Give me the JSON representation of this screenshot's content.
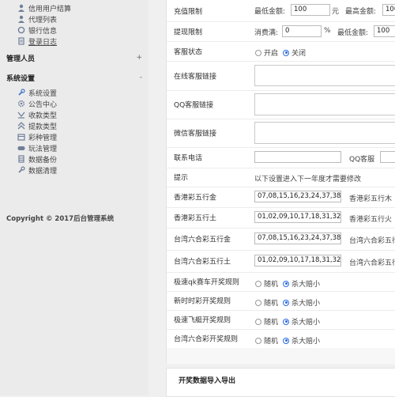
{
  "sidebar": {
    "menu_top": [
      {
        "label": "信用用户结算",
        "icon": "user-icon"
      },
      {
        "label": "代理列表",
        "icon": "user-icon"
      },
      {
        "label": "银行信息",
        "icon": "circle-icon"
      },
      {
        "label": "登录日志",
        "icon": "document-icon"
      }
    ],
    "groups": [
      {
        "label": "管理人员",
        "toggle": "+"
      },
      {
        "label": "系统设置",
        "toggle": "-"
      }
    ],
    "settings_items": [
      {
        "label": "系统设置",
        "icon": "wrench-icon"
      },
      {
        "label": "公告中心",
        "icon": "gear-icon"
      },
      {
        "label": "收款类型",
        "icon": "download-icon"
      },
      {
        "label": "提款类型",
        "icon": "upload-icon"
      },
      {
        "label": "彩种管理",
        "icon": "folder-icon"
      },
      {
        "label": "玩法管理",
        "icon": "gamepad-icon"
      },
      {
        "label": "数据备份",
        "icon": "database-icon"
      },
      {
        "label": "数据清理",
        "icon": "wrench-icon"
      }
    ],
    "copyright": "Copyright © 2017后台管理系统"
  },
  "form": {
    "recharge": {
      "label": "充值限制",
      "min_label": "最低金额:",
      "min_value": "100",
      "unit": "元",
      "max_label": "最高金额:",
      "max_value": "100"
    },
    "withdraw": {
      "label": "提现限制",
      "consume_label": "消费满:",
      "consume_value": "0",
      "percent": "%",
      "min_label": "最低金额:",
      "min_value": "100"
    },
    "service_status": {
      "label": "客服状态",
      "on": "开启",
      "off": "关闭",
      "selected": "off"
    },
    "online_service": {
      "label": "在线客服链接"
    },
    "qq_service": {
      "label": "QQ客服链接"
    },
    "wechat_service": {
      "label": "微信客服链接"
    },
    "contact": {
      "label": "联系电话",
      "qq_label": "QQ客服"
    },
    "tip": {
      "label": "提示",
      "text": "以下设置进入下一年度才需要修改"
    },
    "elements": [
      {
        "label": "香港彩五行金",
        "value": "07,08,15,16,23,24,37,38,45,",
        "next_label": "香港彩五行木"
      },
      {
        "label": "香港彩五行土",
        "value": "01,02,09,10,17,18,31,32,39,",
        "next_label": "香港彩五行火"
      },
      {
        "label": "台湾六合彩五行金",
        "value": "07,08,15,16,23,24,37,38,45,",
        "next_label": "台湾六合彩五行"
      },
      {
        "label": "台湾六合彩五行土",
        "value": "01,02,09,10,17,18,31,32,39,",
        "next_label": "台湾六合彩五行"
      }
    ],
    "rules": [
      {
        "label": "极速qk赛车开奖规则",
        "opt1": "随机",
        "opt2": "杀大赔小",
        "selected": "opt2"
      },
      {
        "label": "新时时彩开奖规则",
        "opt1": "随机",
        "opt2": "杀大赔小",
        "selected": "opt2"
      },
      {
        "label": "极速飞艇开奖规则",
        "opt1": "随机",
        "opt2": "杀大赔小",
        "selected": "opt2"
      },
      {
        "label": "台湾六合彩开奖规则",
        "opt1": "随机",
        "opt2": "杀大赔小",
        "selected": "opt2"
      }
    ]
  },
  "section2": {
    "title": "开奖数据导入导出"
  }
}
